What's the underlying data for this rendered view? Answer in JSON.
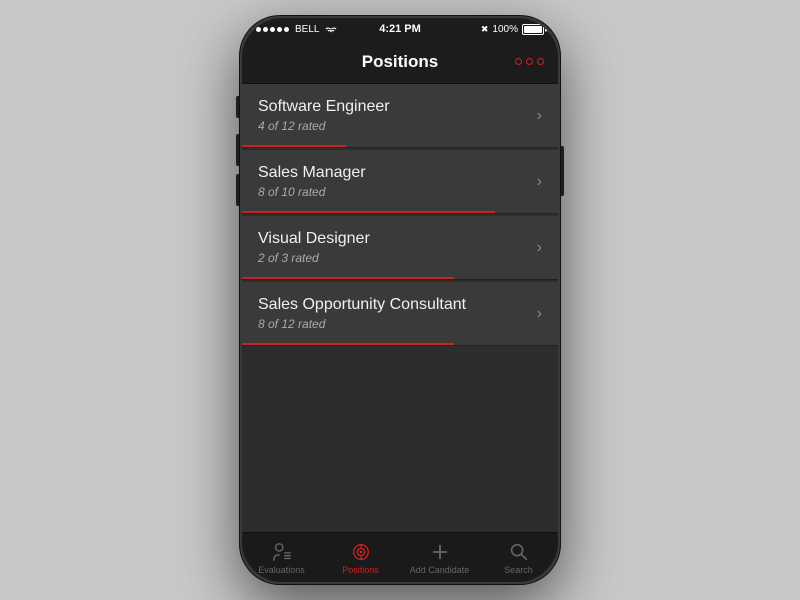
{
  "statusBar": {
    "carrier": "BELL",
    "time": "4:21 PM",
    "battery": "100%"
  },
  "navBar": {
    "title": "Positions",
    "moreButton": "more"
  },
  "positions": [
    {
      "title": "Software Engineer",
      "subtitle": "4 of 12 rated",
      "progressPercent": 33,
      "id": "software-engineer"
    },
    {
      "title": "Sales Manager",
      "subtitle": "8 of 10 rated",
      "progressPercent": 80,
      "id": "sales-manager"
    },
    {
      "title": "Visual Designer",
      "subtitle": "2 of 3 rated",
      "progressPercent": 67,
      "id": "visual-designer"
    },
    {
      "title": "Sales Opportunity Consultant",
      "subtitle": "8 of 12 rated",
      "progressPercent": 67,
      "id": "sales-opportunity-consultant"
    }
  ],
  "tabBar": {
    "items": [
      {
        "label": "Evaluations",
        "icon": "evaluations",
        "active": false
      },
      {
        "label": "Positions",
        "icon": "positions",
        "active": true
      },
      {
        "label": "Add Candidate",
        "icon": "add",
        "active": false
      },
      {
        "label": "Search",
        "icon": "search",
        "active": false
      }
    ]
  }
}
